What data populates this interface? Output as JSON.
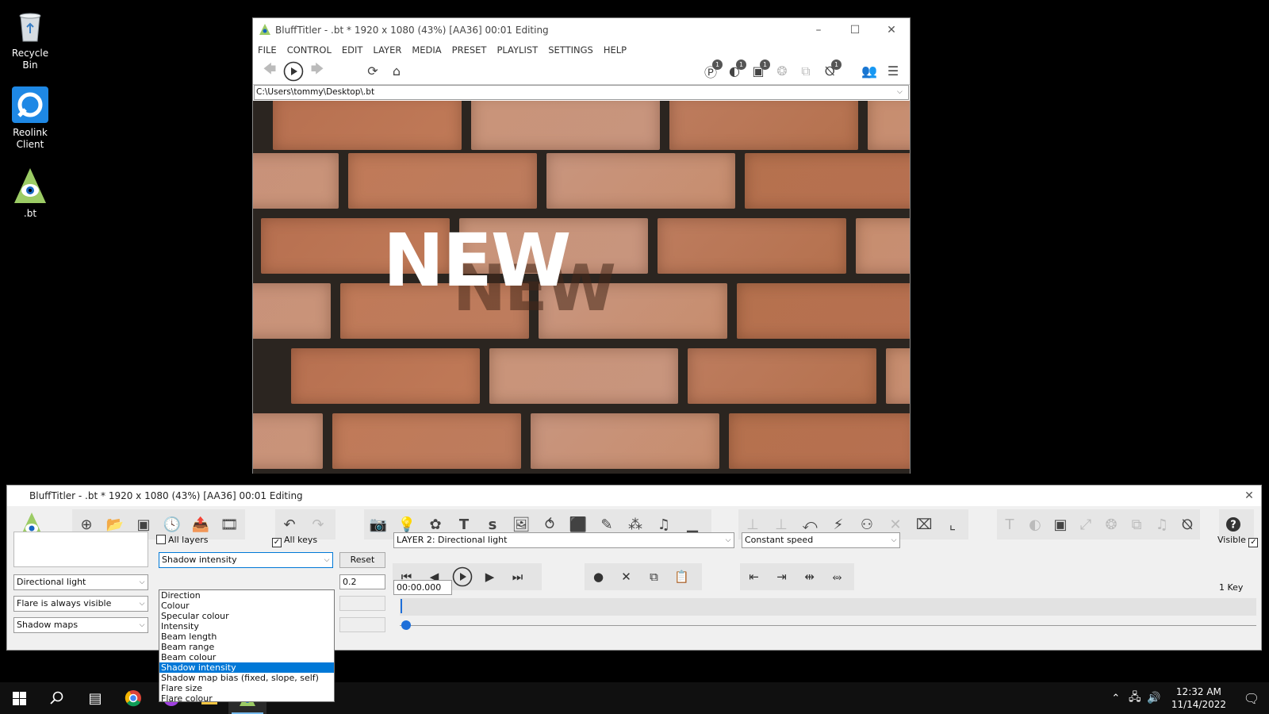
{
  "desktop": {
    "icons": [
      {
        "label": "Recycle Bin",
        "icon": "recycle-bin-icon"
      },
      {
        "label": "Reolink Client",
        "icon": "reolink-icon"
      },
      {
        "label": ".bt",
        "icon": "blufftitler-icon"
      }
    ]
  },
  "preview_window": {
    "title": "BluffTitler - .bt * 1920 x 1080 (43%) [AA36] 00:01 Editing",
    "menu": [
      "FILE",
      "CONTROL",
      "EDIT",
      "LAYER",
      "MEDIA",
      "PRESET",
      "PLAYLIST",
      "SETTINGS",
      "HELP"
    ],
    "badges": [
      "1",
      "1",
      "1",
      "1"
    ],
    "path": "C:\\Users\\tommy\\Desktop\\.bt",
    "scene_text": "NEW"
  },
  "editor_window": {
    "title": "BluffTitler - .bt * 1920 x 1080 (43%) [AA36] 00:01 Editing",
    "all_layers_label": "All layers",
    "all_keys_label": "All keys",
    "layer_type": "Directional light",
    "flare_mode": "Flare is always visible",
    "shadow_mode": "Shadow maps",
    "property": "Shadow intensity",
    "reset_label": "Reset",
    "value": "0.2",
    "layer_select": "LAYER 2: Directional light",
    "speed_select": "Constant speed",
    "visible_label": "Visible",
    "time": "00:00.000",
    "keys_count": "1 Key",
    "property_options": [
      "Direction",
      "Colour",
      "Specular colour",
      "Intensity",
      "Beam length",
      "Beam range",
      "Beam colour",
      "Shadow intensity",
      "Shadow map bias (fixed, slope, self)",
      "Flare size",
      "Flare colour"
    ],
    "selected_option": "Shadow intensity"
  },
  "taskbar": {
    "time": "12:32 AM",
    "date": "11/14/2022"
  },
  "colors": {
    "accent": "#0078d7",
    "brick_light": "#c78d6e",
    "brick_dark": "#b5714e",
    "mortar": "#1e1a17"
  }
}
